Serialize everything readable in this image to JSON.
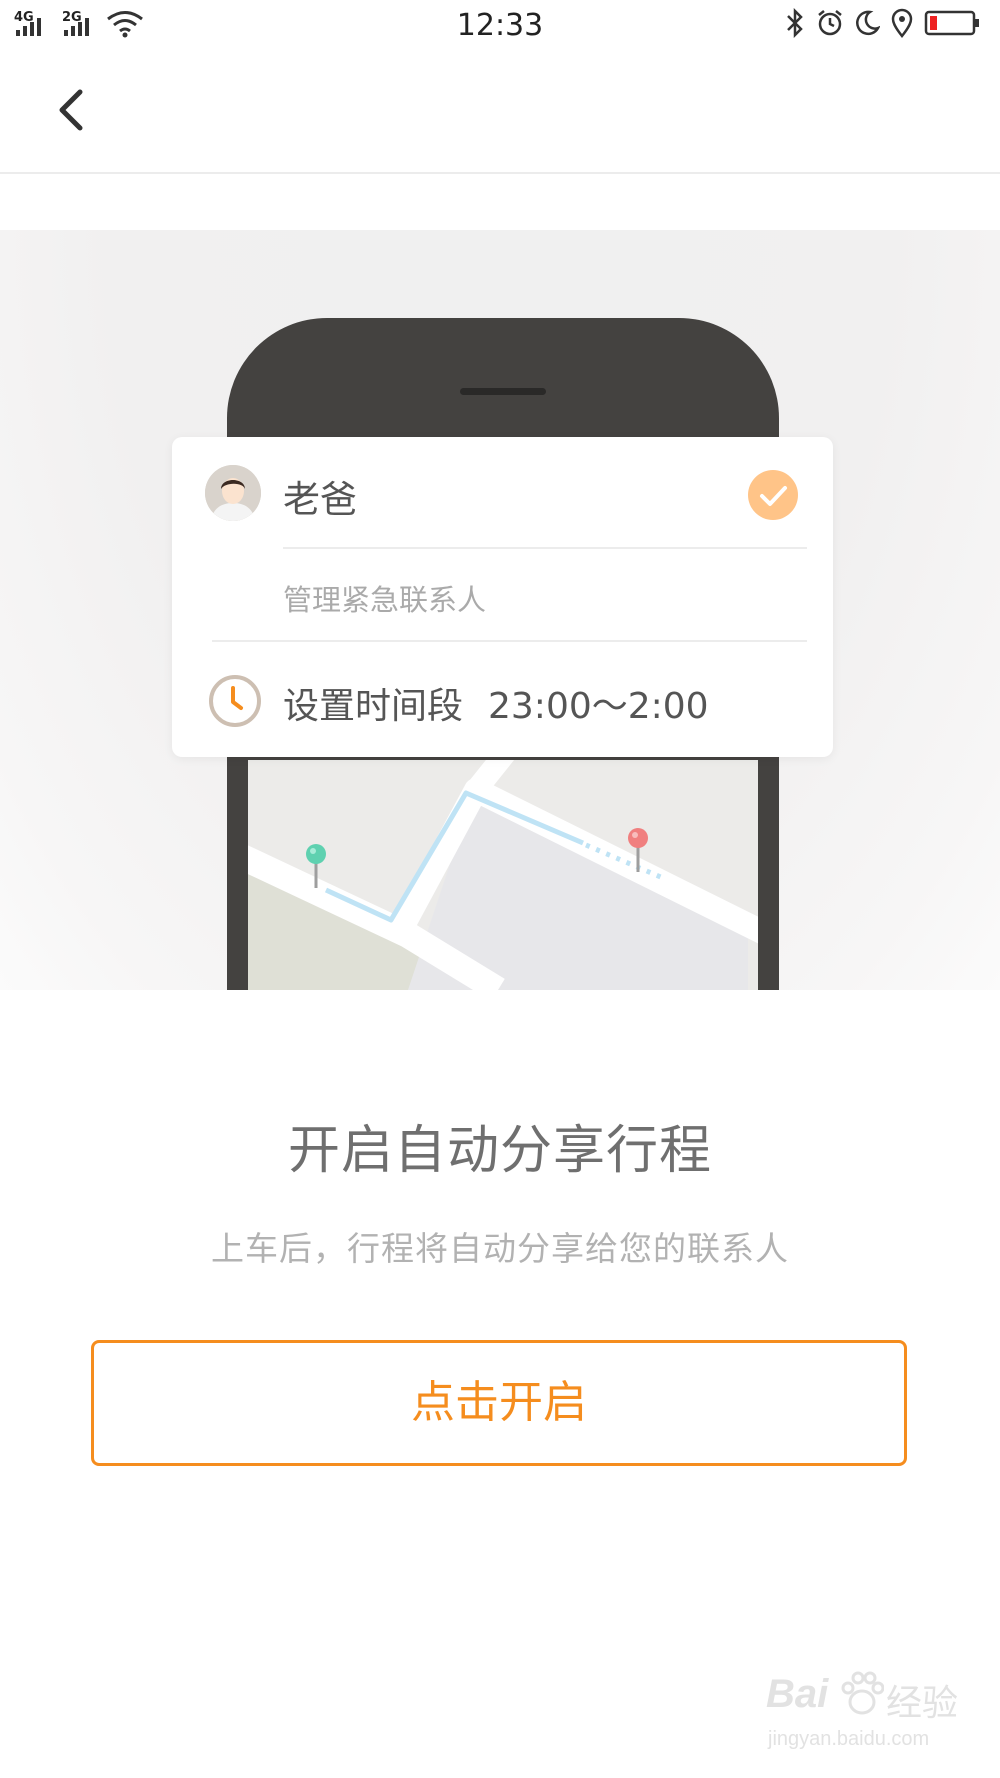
{
  "status_bar": {
    "signal1_label": "4G",
    "signal2_label": "2G",
    "time": "12:33",
    "icons": [
      "bluetooth-icon",
      "alarm-icon",
      "moon-icon",
      "location-icon",
      "battery-low-icon"
    ]
  },
  "nav": {
    "back_icon": "chevron-left-icon"
  },
  "card": {
    "contact_name": "老爸",
    "manage_label": "管理紧急联系人",
    "time_label": "设置时间段",
    "time_value": "23:00～2:00"
  },
  "main": {
    "title": "开启自动分享行程",
    "subtitle": "上车后，行程将自动分享给您的联系人",
    "button_label": "点击开启"
  },
  "watermark": {
    "brand_left": "Bai",
    "brand_right": "经验",
    "url": "jingyan.baidu.com"
  },
  "colors": {
    "accent": "#f58d1e",
    "check_badge": "#ffc488",
    "phone_body": "#444240",
    "route_line": "#bfe3f5",
    "pin_start": "#5fd1b0",
    "pin_end": "#f07f7f"
  }
}
